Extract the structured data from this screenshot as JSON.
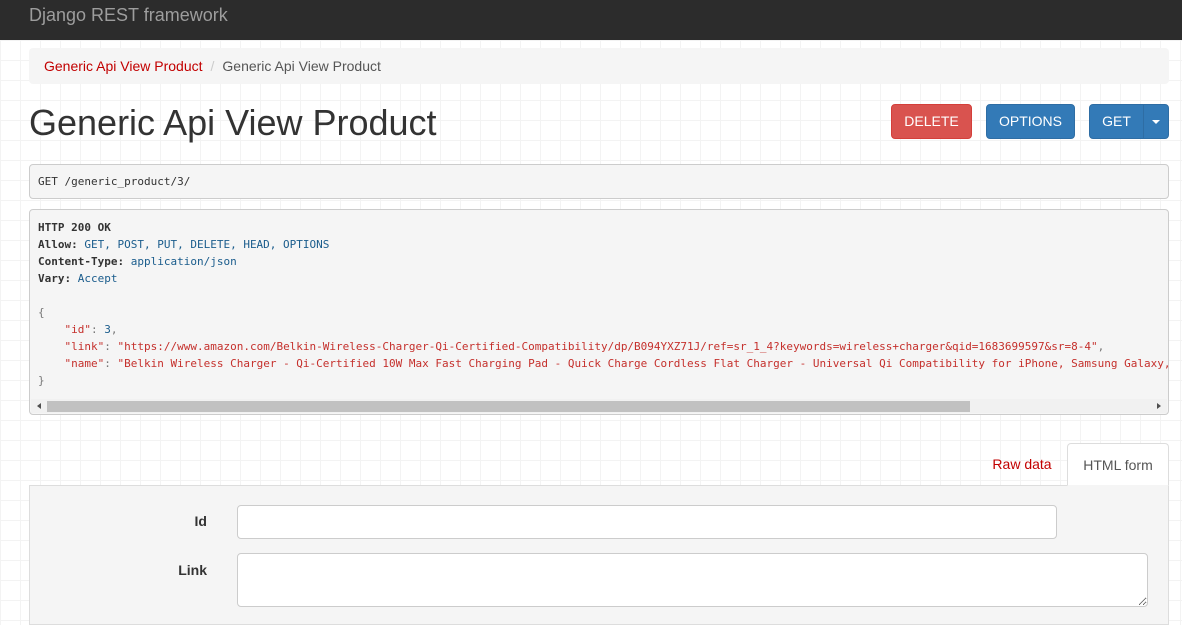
{
  "navbar": {
    "brand": "Django REST framework"
  },
  "breadcrumb": {
    "items": [
      {
        "label": "Generic Api View Product"
      },
      {
        "label": "Generic Api View Product"
      }
    ],
    "separator": "/"
  },
  "page": {
    "title": "Generic Api View Product"
  },
  "buttons": {
    "delete": "DELETE",
    "options": "OPTIONS",
    "get": "GET"
  },
  "colors": {
    "danger": "#d9534f",
    "primary": "#337ab7",
    "link": "#c20000"
  },
  "request": {
    "method": "GET",
    "path": "/generic_product/3/"
  },
  "response": {
    "status": "HTTP 200 OK",
    "headers": [
      {
        "name": "Allow",
        "value": "GET, POST, PUT, DELETE, HEAD, OPTIONS"
      },
      {
        "name": "Content-Type",
        "value": "application/json"
      },
      {
        "name": "Vary",
        "value": "Accept"
      }
    ],
    "body": {
      "open": "{",
      "close": "}",
      "fields": [
        {
          "key": "\"id\"",
          "value": "3",
          "trail": ","
        },
        {
          "key": "\"link\"",
          "value": "\"https://www.amazon.com/Belkin-Wireless-Charger-Qi-Certified-Compatibility/dp/B094YXZ71J/ref=sr_1_4?keywords=wireless+charger&qid=1683699597&sr=8-4\"",
          "trail": ","
        },
        {
          "key": "\"name\"",
          "value": "\"Belkin Wireless Charger - Qi-Certified 10W Max Fast Charging Pad - Quick Charge Cordless Flat Charger - Universal Qi Compatibility for iPhone, Samsung Galaxy,",
          "trail": ""
        }
      ]
    }
  },
  "tabs": {
    "raw": "Raw data",
    "html": "HTML form"
  },
  "form": {
    "id_label": "Id",
    "id_value": "",
    "link_label": "Link",
    "link_value": ""
  }
}
